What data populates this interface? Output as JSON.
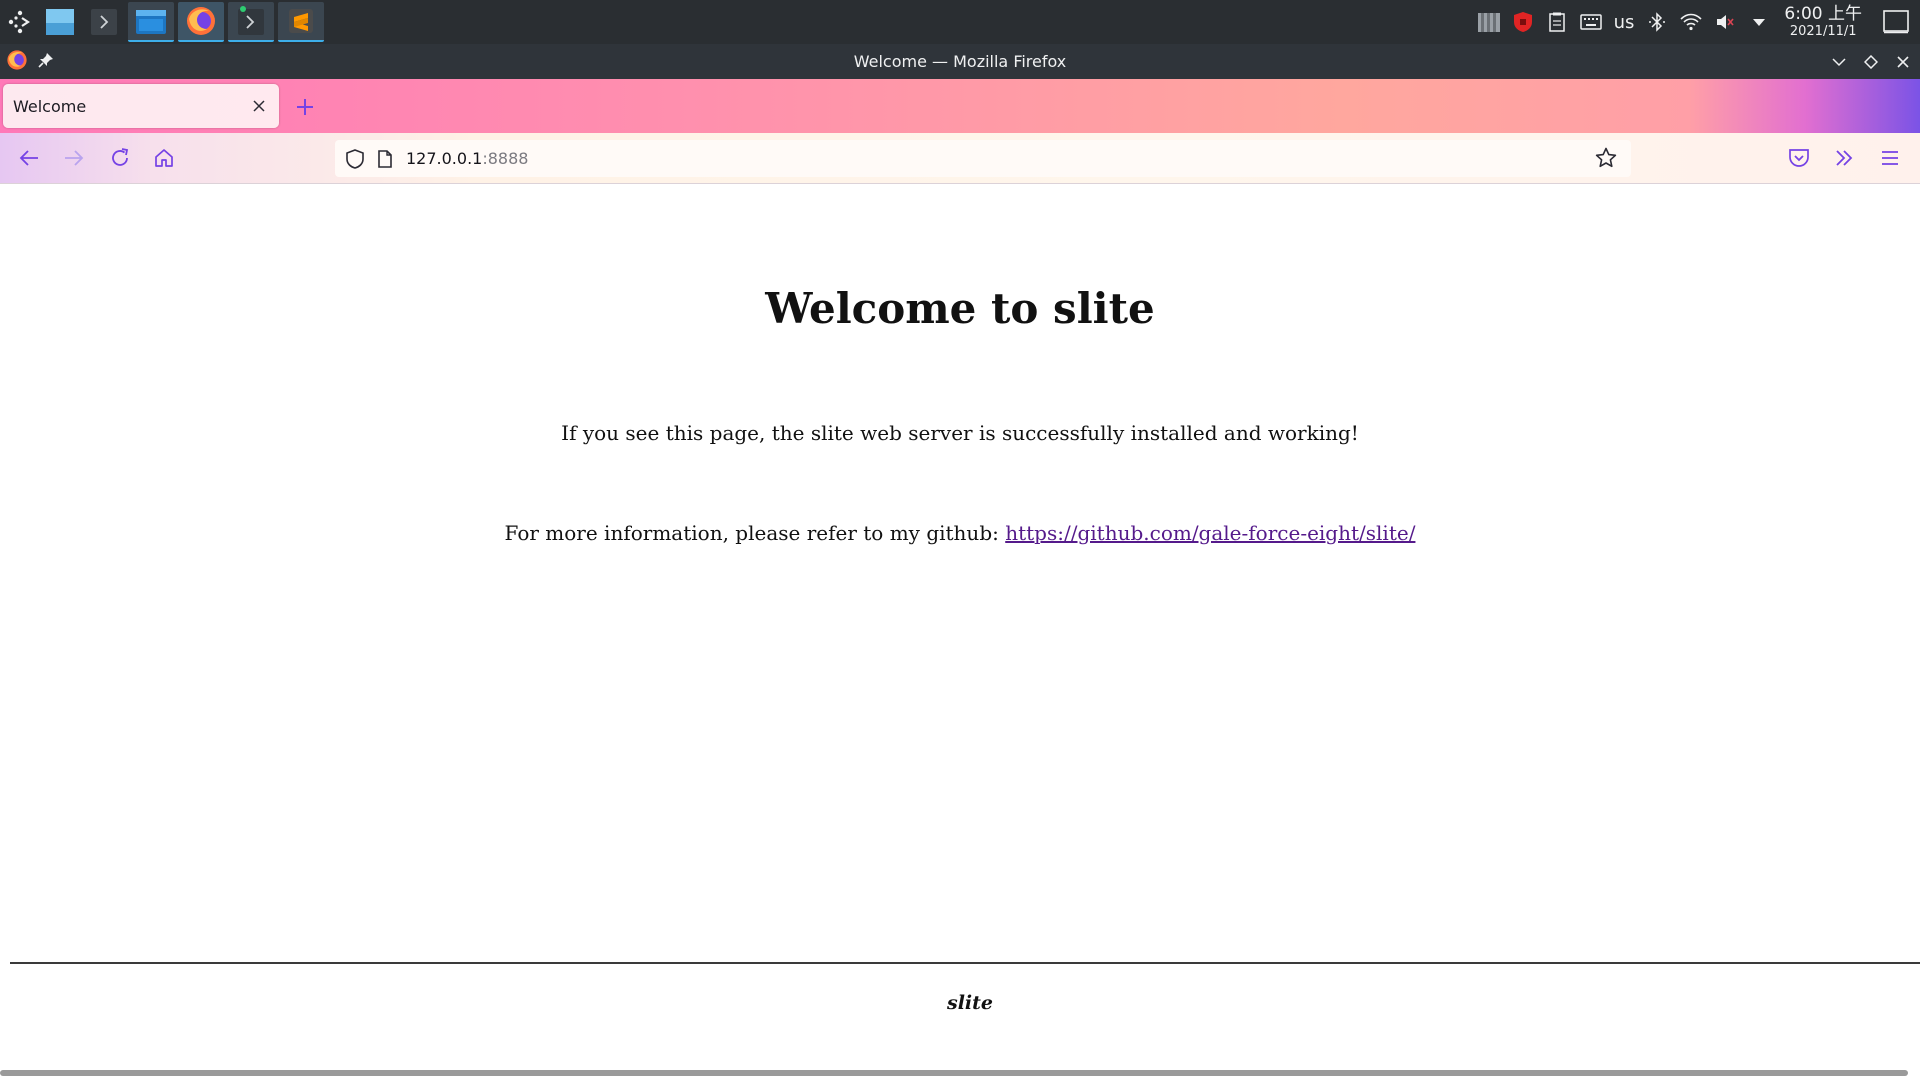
{
  "taskbar": {
    "tray": {
      "keyboard_layout": "us"
    },
    "clock": {
      "time": "6:00 上午",
      "date": "2021/11/1"
    }
  },
  "window": {
    "title": "Welcome — Mozilla Firefox"
  },
  "browser": {
    "tab": {
      "label": "Welcome"
    },
    "url": {
      "host": "127.0.0.1",
      "port": ":8888"
    }
  },
  "page": {
    "heading": "Welcome to slite",
    "intro": "If you see this page, the slite web server is successfully installed and working!",
    "info_prefix": "For more information, please refer to my github: ",
    "github_link": "https://github.com/gale-force-eight/slite/",
    "footer": "slite"
  },
  "colors": {
    "taskbar_bg": "#2a2e32",
    "titlebar_bg": "#2f343a",
    "link": "#551a8b",
    "accent": "#3daee9"
  }
}
